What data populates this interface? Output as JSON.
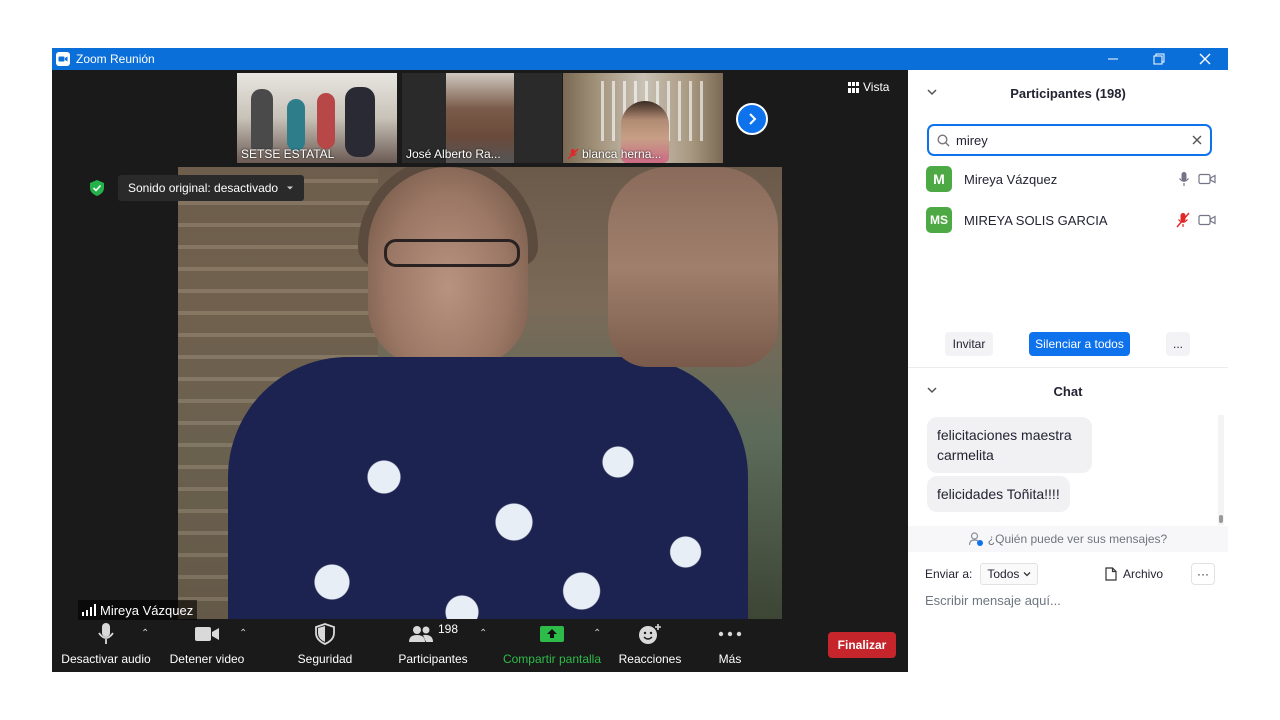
{
  "window": {
    "title": "Zoom Reunión"
  },
  "video": {
    "thumbnails": [
      {
        "label": "SETSE ESTATAL"
      },
      {
        "label": "José Alberto Ra..."
      },
      {
        "label": "blanca herna..."
      }
    ],
    "view_label": "Vista",
    "sound_label": "Sonido original: desactivado",
    "active_speaker": "Mireya Vázquez"
  },
  "toolbar": {
    "mute_label": "Desactivar audio",
    "video_label": "Detener video",
    "security_label": "Seguridad",
    "participants_label": "Participantes",
    "participants_count": "198",
    "share_label": "Compartir pantalla",
    "reactions_label": "Reacciones",
    "more_label": "Más",
    "end_label": "Finalizar"
  },
  "participants_panel": {
    "title": "Participantes (198)",
    "search_value": "mirey",
    "participants": [
      {
        "initials": "M",
        "name": "Mireya Vázquez",
        "muted": false
      },
      {
        "initials": "MS",
        "name": "MIREYA SOLIS GARCIA",
        "muted": true
      }
    ],
    "invite_label": "Invitar",
    "mute_all_label": "Silenciar a todos",
    "more_label": "..."
  },
  "chat_panel": {
    "title": "Chat",
    "messages": [
      {
        "text": "felicitaciones maestra carmelita"
      },
      {
        "text": "felicidades Toñita!!!!"
      }
    ],
    "who_sees": "¿Quién puede ver sus mensajes?",
    "send_to_label": "Enviar a:",
    "send_to_value": "Todos",
    "file_label": "Archivo",
    "more_label": "···",
    "input_placeholder": "Escribir mensaje aquí..."
  },
  "colors": {
    "zoom_blue": "#0e72ed",
    "end_red": "#c6262b",
    "share_green": "#2dbb4a",
    "mute_red": "#e02828"
  }
}
